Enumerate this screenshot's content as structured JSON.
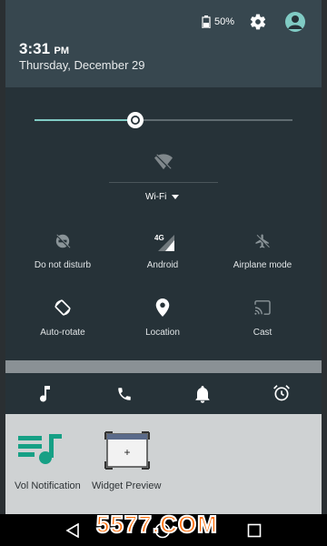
{
  "status": {
    "battery": "50%",
    "time": "3:31",
    "ampm": "PM",
    "date": "Thursday, December 29"
  },
  "brightness": {
    "level": 0.39
  },
  "wifi": {
    "label": "Wi-Fi"
  },
  "tiles": [
    {
      "label": "Do not disturb",
      "icon": "do-not-disturb-icon"
    },
    {
      "label": "Android",
      "icon": "signal-4g-icon",
      "badge": "4G"
    },
    {
      "label": "Airplane mode",
      "icon": "airplane-icon"
    },
    {
      "label": "Auto-rotate",
      "icon": "auto-rotate-icon"
    },
    {
      "label": "Location",
      "icon": "location-pin-icon"
    },
    {
      "label": "Cast",
      "icon": "cast-icon"
    }
  ],
  "notification_icons": [
    "music-note-icon",
    "phone-icon",
    "bell-icon",
    "alarm-clock-icon"
  ],
  "home": {
    "apps": [
      {
        "label": "Vol Notification"
      },
      {
        "label": "Widget Preview"
      }
    ]
  },
  "watermark": "5577.COM",
  "colors": {
    "shade_top": "#37474f",
    "shade_panel": "#263238",
    "accent": "#80cbc4",
    "vol_icon": "#16a085"
  }
}
